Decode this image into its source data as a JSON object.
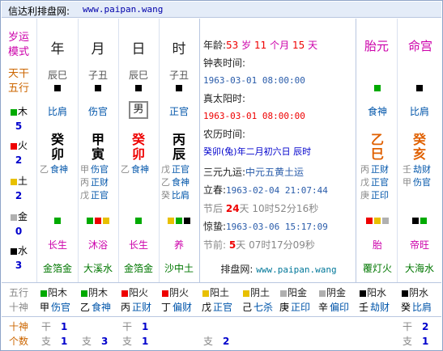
{
  "header": {
    "title": "信达利排盘网:",
    "url": "www.paipan.wang"
  },
  "cols": {
    "label1": "岁运",
    "label2": "模式",
    "year": "年",
    "month": "月",
    "day": "日",
    "hour": "时",
    "taiyuan": "胎元",
    "minggong": "命宫"
  },
  "tiangan": {
    "l1": "天干",
    "l2": "五行"
  },
  "wuxing": [
    {
      "name": "木",
      "count": "5"
    },
    {
      "name": "火",
      "count": "2"
    },
    {
      "name": "土",
      "count": "2"
    },
    {
      "name": "金",
      "count": "0"
    },
    {
      "name": "水",
      "count": "3"
    }
  ],
  "pillars": [
    {
      "hide": "辰巳",
      "shishen": "比肩",
      "gan": "癸",
      "zhi": "卯",
      "cang": [
        {
          "g": "乙",
          "s": "食神"
        }
      ],
      "cs": "长生",
      "ny": "金箔金"
    },
    {
      "hide": "子丑",
      "shishen": "伤官",
      "gan": "甲",
      "zhi": "寅",
      "cang": [
        {
          "g": "甲",
          "s": "伤官"
        },
        {
          "g": "丙",
          "s": "正财"
        },
        {
          "g": "戊",
          "s": "正官"
        }
      ],
      "cs": "沐浴",
      "ny": "大溪水"
    },
    {
      "hide": "辰巳",
      "shishen": "男",
      "gan": "癸",
      "zhi": "卯",
      "cang": [
        {
          "g": "乙",
          "s": "食神"
        }
      ],
      "cs": "长生",
      "ny": "金箔金"
    },
    {
      "hide": "子丑",
      "shishen": "正官",
      "gan": "丙",
      "zhi": "辰",
      "cang": [
        {
          "g": "戊",
          "s": "正官"
        },
        {
          "g": "乙",
          "s": "食神"
        },
        {
          "g": "癸",
          "s": "比肩"
        }
      ],
      "cs": "养",
      "ny": "沙中土"
    }
  ],
  "side": [
    {
      "shishen": "食神",
      "gan": "乙",
      "zhi": "巳",
      "cang": [
        {
          "g": "丙",
          "s": "正财"
        },
        {
          "g": "戊",
          "s": "正官"
        },
        {
          "g": "庚",
          "s": "正印"
        }
      ],
      "cs": "胎",
      "ny": "覆灯火"
    },
    {
      "shishen": "比肩",
      "gan": "癸",
      "zhi": "亥",
      "cang": [
        {
          "g": "壬",
          "s": "劫财"
        },
        {
          "g": "甲",
          "s": "伤官"
        }
      ],
      "cs": "帝旺",
      "ny": "大海水"
    }
  ],
  "info": {
    "age_l": "年龄:",
    "age_v": "53",
    "age_u1": "岁",
    "age_m": "11",
    "age_u2": "个月",
    "age_d": "15",
    "age_u3": "天",
    "clock_l": "钟表时间:",
    "clock_v": "1963-03-01 08:00:00",
    "solar_l": "真太阳时:",
    "solar_v": "1963-03-01 08:00:00",
    "lunar_l": "农历时间:",
    "lunar_v": "癸卯(兔)年二月初六日 辰时",
    "sanyuan_l": "三元九运:",
    "sanyuan_v": "中元五黄土运",
    "lichun_l": "立春:",
    "lichun_v": "1963-02-04 21:07:44",
    "jq1_l": "节后",
    "jq1_d": "24",
    "jq1_u": "天",
    "jq1_t": "10时52分16秒",
    "jz_l": "惊蛰:",
    "jz_v": "1963-03-06 15:17:09",
    "jq2_l": "节前:",
    "jq2_d": "5",
    "jq2_u": "天",
    "jq2_t": "07时17分09秒",
    "site_l": "排盘网:",
    "site_v": "www.paipan.wang"
  },
  "bottom": {
    "l1": "五行",
    "l2": "十神",
    "l3": "十神",
    "l4": "个数",
    "cells": [
      {
        "g": "甲",
        "e": "阳木",
        "t": "甲",
        "s": "伤官"
      },
      {
        "g": "乙",
        "e": "阴木",
        "t": "乙",
        "s": "食神"
      },
      {
        "g": "丙",
        "e": "阳火",
        "t": "丙",
        "s": "正财"
      },
      {
        "g": "丁",
        "e": "阴火",
        "t": "丁",
        "s": "偏财"
      },
      {
        "g": "戊",
        "e": "阳土",
        "t": "戊",
        "s": "正官"
      },
      {
        "g": "己",
        "e": "阴土",
        "t": "己",
        "s": "七杀"
      },
      {
        "g": "庚",
        "e": "阳金",
        "t": "庚",
        "s": "正印"
      },
      {
        "g": "辛",
        "e": "阴金",
        "t": "辛",
        "s": "偏印"
      },
      {
        "g": "壬",
        "e": "阳水",
        "t": "壬",
        "s": "劫财"
      },
      {
        "g": "癸",
        "e": "阴水",
        "t": "癸",
        "s": "比肩"
      }
    ],
    "counts": [
      {
        "a": "干",
        "av": "1",
        "b": "支",
        "bv": "1"
      },
      {
        "a": "",
        "av": "",
        "b": "支",
        "bv": "3"
      },
      {
        "a": "干",
        "av": "1",
        "b": "支",
        "bv": "1"
      },
      {
        "a": "",
        "av": "",
        "b": "",
        "bv": ""
      },
      {
        "a": "",
        "av": "",
        "b": "支",
        "bv": "2"
      },
      {
        "a": "",
        "av": "",
        "b": "",
        "bv": ""
      },
      {
        "a": "",
        "av": "",
        "b": "",
        "bv": ""
      },
      {
        "a": "",
        "av": "",
        "b": "",
        "bv": ""
      },
      {
        "a": "",
        "av": "",
        "b": "",
        "bv": ""
      },
      {
        "a": "干",
        "av": "2",
        "b": "支",
        "bv": "1"
      }
    ]
  },
  "colors": {
    "wood": "#00aa00",
    "fire": "#ee0000",
    "earth": "#e8c000",
    "metal": "#b0b0b0",
    "water": "#000000",
    "frame": "#8ea4c8"
  }
}
